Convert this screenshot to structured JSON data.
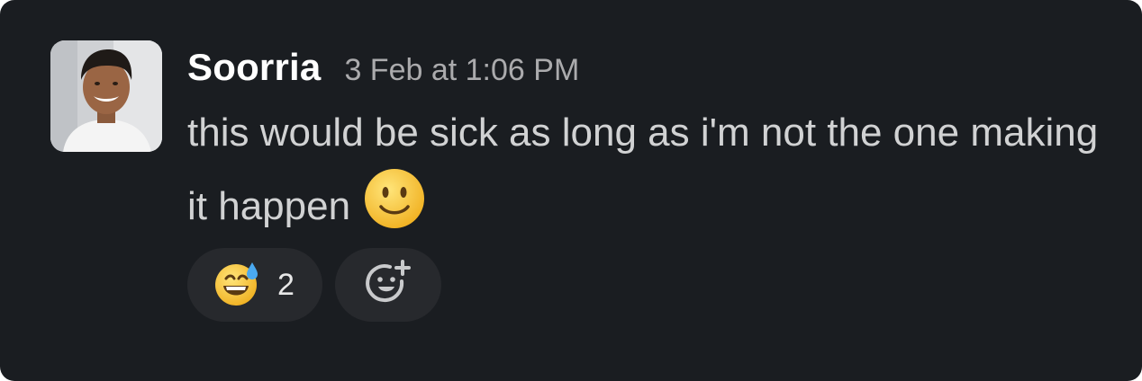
{
  "message": {
    "author": "Soorria",
    "timestamp": "3 Feb at 1:06 PM",
    "text": "this would be sick as long as i'm not the one making it happen",
    "inline_emoji": "slightly-smiling-face"
  },
  "reactions": [
    {
      "emoji": "grinning-face-with-sweat",
      "count": "2"
    }
  ],
  "add_reaction": {
    "icon": "add-reaction-icon"
  },
  "colors": {
    "background": "#1a1d21",
    "author": "#ffffff",
    "timestamp": "#ababad",
    "message_text": "#d1d2d3",
    "reaction_pill": "#27292d",
    "emoji_yellow": "#f7c132"
  }
}
